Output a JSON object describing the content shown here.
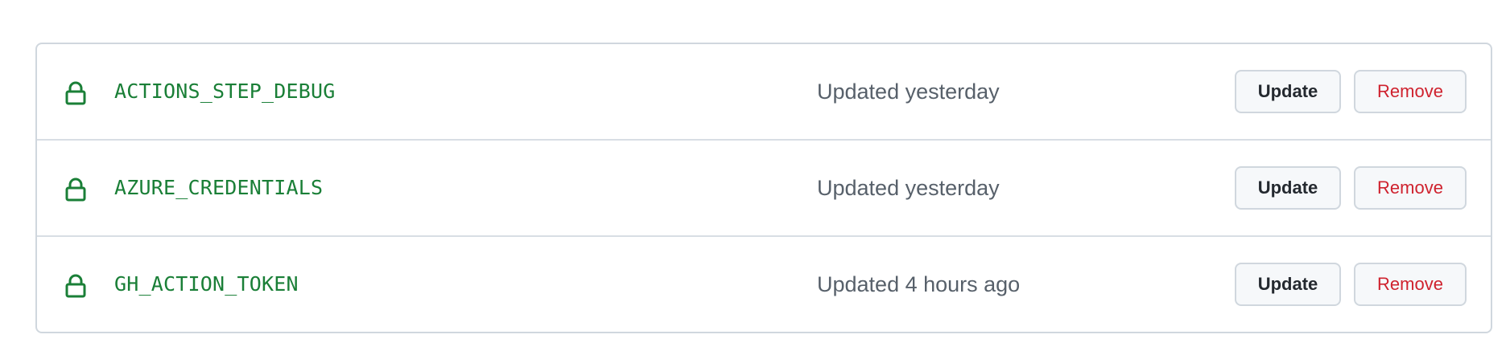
{
  "secrets": {
    "items": [
      {
        "name": "ACTIONS_STEP_DEBUG",
        "updated": "Updated yesterday",
        "update_label": "Update",
        "remove_label": "Remove"
      },
      {
        "name": "AZURE_CREDENTIALS",
        "updated": "Updated yesterday",
        "update_label": "Update",
        "remove_label": "Remove"
      },
      {
        "name": "GH_ACTION_TOKEN",
        "updated": "Updated 4 hours ago",
        "update_label": "Update",
        "remove_label": "Remove"
      }
    ]
  },
  "colors": {
    "secret_name": "#1a7f37",
    "lock_icon": "#1a7f37",
    "remove_text": "#cf222e",
    "muted_text": "#57606a",
    "border": "#d0d7de"
  },
  "icons": {
    "secret": "lock-icon"
  }
}
